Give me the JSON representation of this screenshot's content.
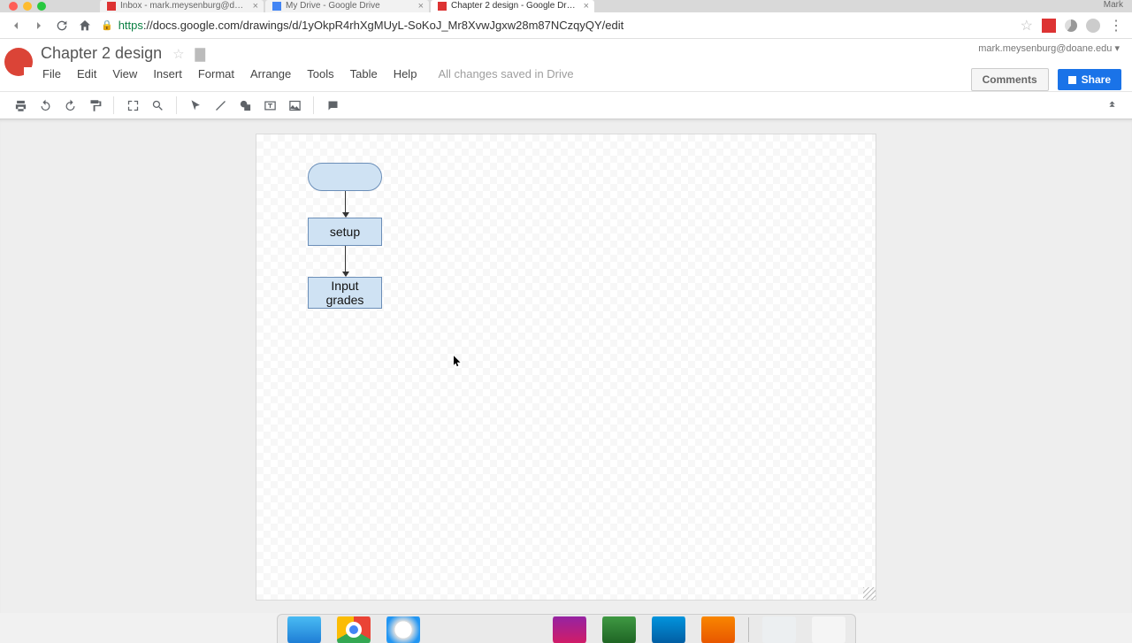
{
  "browser": {
    "tabs": [
      {
        "title": "Inbox - mark.meysenburg@d…"
      },
      {
        "title": "My Drive - Google Drive"
      },
      {
        "title": "Chapter 2 design - Google Dr…"
      }
    ],
    "user_badge": "Mark",
    "url_host": "https",
    "url_rest": "://docs.google.com/drawings/d/1yOkpR4rhXgMUyL-SoKoJ_Mr8XvwJgxw28m87NCzqyQY/edit"
  },
  "doc": {
    "title": "Chapter 2 design",
    "user": "mark.meysenburg@doane.edu ▾",
    "menus": [
      "File",
      "Edit",
      "View",
      "Insert",
      "Format",
      "Arrange",
      "Tools",
      "Table",
      "Help"
    ],
    "saved": "All changes saved in Drive",
    "comments": "Comments",
    "share": "Share"
  },
  "flow": {
    "setup": "setup",
    "input": "Input\ngrades"
  }
}
